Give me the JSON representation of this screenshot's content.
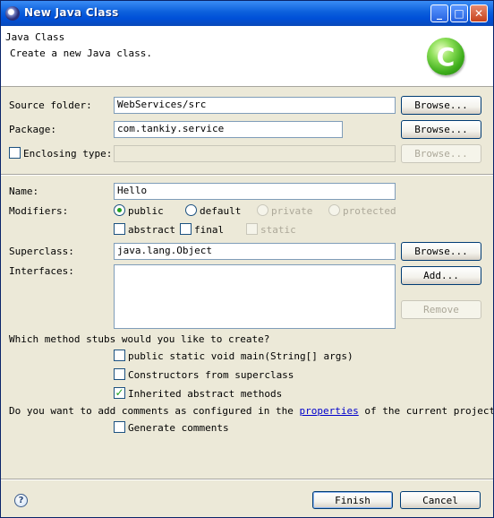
{
  "window": {
    "title": "New Java Class",
    "controls": {
      "minimize": "_",
      "maximize": "□",
      "close": "✕"
    }
  },
  "header": {
    "title": "Java Class",
    "description": "Create a new Java class.",
    "logo_letter": "C"
  },
  "form": {
    "source_folder": {
      "label": "Source folder:",
      "value": "WebServices/src",
      "button": "Browse..."
    },
    "package": {
      "label": "Package:",
      "value": "com.tankiy.service",
      "button": "Browse..."
    },
    "enclosing_type": {
      "label": "Enclosing type:",
      "checked": false,
      "value": "",
      "button": "Browse..."
    },
    "name": {
      "label": "Name:",
      "value": "Hello"
    },
    "modifiers": {
      "label": "Modifiers:",
      "access": [
        {
          "label": "public",
          "selected": true,
          "enabled": true
        },
        {
          "label": "default",
          "selected": false,
          "enabled": true
        },
        {
          "label": "private",
          "selected": false,
          "enabled": false
        },
        {
          "label": "protected",
          "selected": false,
          "enabled": false
        }
      ],
      "flags": [
        {
          "label": "abstract",
          "checked": false,
          "enabled": true
        },
        {
          "label": "final",
          "checked": false,
          "enabled": true
        },
        {
          "label": "static",
          "checked": false,
          "enabled": false
        }
      ]
    },
    "superclass": {
      "label": "Superclass:",
      "value": "java.lang.Object",
      "button": "Browse..."
    },
    "interfaces": {
      "label": "Interfaces:",
      "add_button": "Add...",
      "remove_button": "Remove"
    }
  },
  "stubs": {
    "question": "Which method stubs would you like to create?",
    "options": [
      {
        "label": "public static void main(String[] args)",
        "checked": false
      },
      {
        "label": "Constructors from superclass",
        "checked": false
      },
      {
        "label": "Inherited abstract methods",
        "checked": true
      }
    ]
  },
  "comments": {
    "question_before": "Do you want to add comments as configured in the ",
    "question_link": "properties",
    "question_after": " of the current project?",
    "option": {
      "label": "Generate comments",
      "checked": false
    }
  },
  "footer": {
    "help": "?",
    "finish": "Finish",
    "cancel": "Cancel"
  },
  "colors": {
    "titlebar": "#0b5fdc",
    "check_mark": "#21a121",
    "link": "#0000cc",
    "dialog_bg": "#ece9d8"
  }
}
